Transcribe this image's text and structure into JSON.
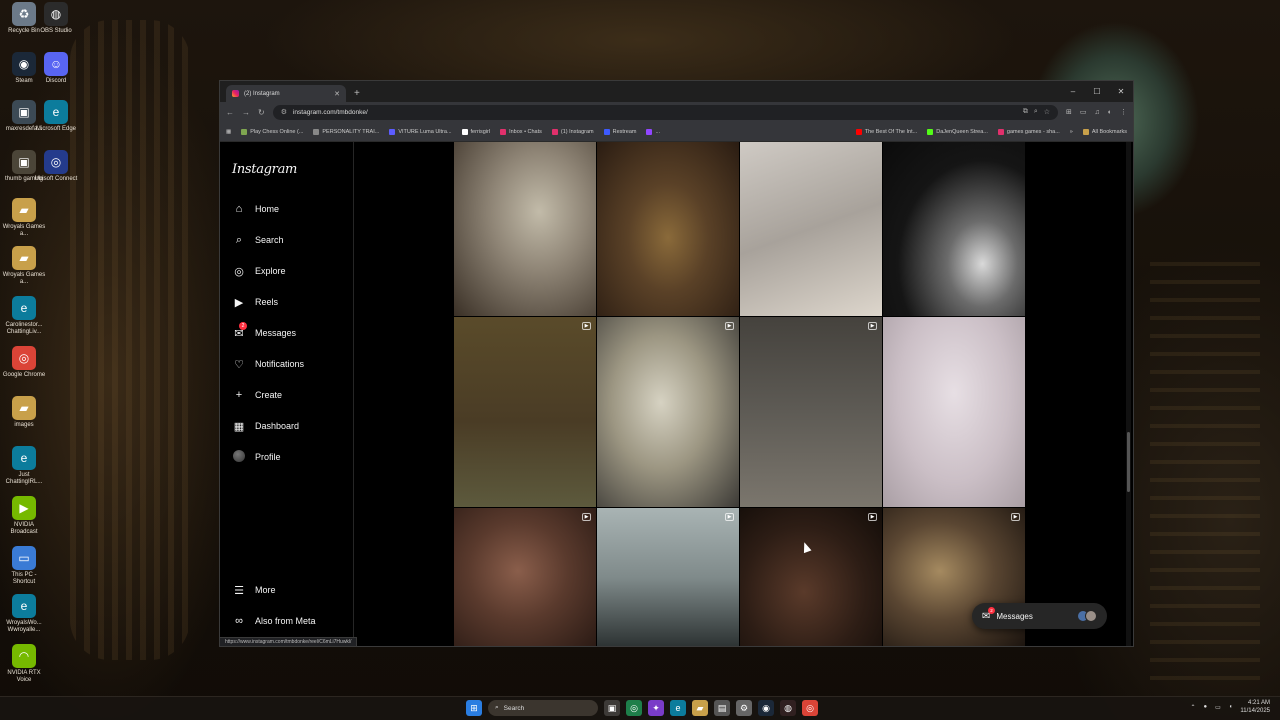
{
  "desktop": {
    "icons": [
      {
        "label": "Recycle Bin",
        "icon": "recycle-bin-icon",
        "color": "#6c7a89"
      },
      {
        "label": "OBS Studio",
        "icon": "obs-icon",
        "color": "#2b2b2b"
      },
      {
        "label": "Steam",
        "icon": "steam-icon",
        "color": "#1b2838"
      },
      {
        "label": "Discord",
        "icon": "discord-icon",
        "color": "#5865f2"
      },
      {
        "label": "maxresdefa...",
        "icon": "image-file-icon",
        "color": "#3c4a55"
      },
      {
        "label": "Microsoft Edge",
        "icon": "edge-icon",
        "color": "#0c7c9c"
      },
      {
        "label": "thumb gaming",
        "icon": "image-file-icon",
        "color": "#4b4538"
      },
      {
        "label": "Ubisoft Connect",
        "icon": "ubisoft-icon",
        "color": "#243b8c"
      },
      {
        "label": "Wroyals Games a...",
        "icon": "folder-icon",
        "color": "#c8a04a"
      },
      {
        "label": "Wroyals Games a...",
        "icon": "folder-icon",
        "color": "#c8a04a"
      },
      {
        "label": "Carolinestor... ChattingLiv...",
        "icon": "edge-icon",
        "color": "#0c7c9c"
      },
      {
        "label": "Google Chrome",
        "icon": "chrome-icon",
        "color": "#db4437"
      },
      {
        "label": "images",
        "icon": "folder-icon",
        "color": "#c8a04a"
      },
      {
        "label": "Just ChattingIRL...",
        "icon": "edge-icon",
        "color": "#0c7c9c"
      },
      {
        "label": "NVIDIA Broadcast",
        "icon": "nvidia-icon",
        "color": "#76b900"
      },
      {
        "label": "This PC - Shortcut",
        "icon": "computer-icon",
        "color": "#3a7bd5"
      },
      {
        "label": "WroyalsWo... Wwroyalle...",
        "icon": "edge-icon",
        "color": "#0c7c9c"
      },
      {
        "label": "NVIDIA RTX Voice",
        "icon": "headset-icon",
        "color": "#76b900"
      }
    ]
  },
  "browser": {
    "tab_title": "(2) Instagram",
    "new_tab": "+",
    "window_controls": {
      "minimize": "–",
      "maximize": "☐",
      "close": "✕"
    },
    "url": "instagram.com/tmbdonke/",
    "bookmarks": [
      {
        "label": "Play Chess Online (...",
        "color": "#7fa650"
      },
      {
        "label": "PERSONALITY TRAI...",
        "color": "#888888"
      },
      {
        "label": "VITURE Luma Ultra...",
        "color": "#5c5cff"
      },
      {
        "label": "ferrisgirl",
        "color": "#ffffff"
      },
      {
        "label": "Inbox • Chats",
        "color": "#e1306c"
      },
      {
        "label": "(1) Instagram",
        "color": "#e1306c"
      },
      {
        "label": "Restream",
        "color": "#3d5afe"
      },
      {
        "label": "...",
        "color": "#9146ff"
      }
    ],
    "bookmarks_right": [
      {
        "label": "The Best Of The Int...",
        "color": "#ff0000"
      },
      {
        "label": "DaJenQueen Strea...",
        "color": "#53fc18"
      },
      {
        "label": "games games - sha...",
        "color": "#e1306c"
      }
    ],
    "all_bookmarks": "All Bookmarks",
    "status_url": "https://www.instagram.com/tmbdonke/reel/C6mLi7Huwkl/"
  },
  "instagram": {
    "logo": "Instagram",
    "nav": [
      {
        "label": "Home",
        "icon": "home-icon"
      },
      {
        "label": "Search",
        "icon": "search-icon"
      },
      {
        "label": "Explore",
        "icon": "compass-icon"
      },
      {
        "label": "Reels",
        "icon": "reels-icon"
      },
      {
        "label": "Messages",
        "icon": "messenger-icon",
        "badge": "2"
      },
      {
        "label": "Notifications",
        "icon": "heart-icon"
      },
      {
        "label": "Create",
        "icon": "plus-icon"
      },
      {
        "label": "Dashboard",
        "icon": "dashboard-icon"
      },
      {
        "label": "Profile",
        "icon": "avatar"
      }
    ],
    "bottom_nav": [
      {
        "label": "More",
        "icon": "menu-icon"
      },
      {
        "label": "Also from Meta",
        "icon": "meta-icon"
      }
    ],
    "messages_pill": {
      "label": "Messages",
      "badge": "2"
    },
    "posts": [
      {
        "reel": false
      },
      {
        "reel": false
      },
      {
        "reel": false
      },
      {
        "reel": false
      },
      {
        "reel": true
      },
      {
        "reel": true
      },
      {
        "reel": true
      },
      {
        "reel": false
      },
      {
        "reel": true
      },
      {
        "reel": true
      },
      {
        "reel": true
      },
      {
        "reel": true
      }
    ]
  },
  "taskbar": {
    "search_placeholder": "Search",
    "time": "4:21 AM",
    "date": "11/14/2025"
  }
}
